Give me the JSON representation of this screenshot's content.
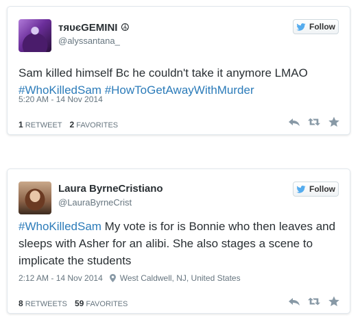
{
  "tweets": [
    {
      "display_name": "тяυєGEMINI ☮",
      "handle": "@alyssantana_",
      "follow_label": "Follow",
      "text_line1": "Sam killed himself Bc he couldn't take it anymore LMAO",
      "hashtag1": "#WhoKilledSam",
      "hashtag2": "#HowToGetAwayWithMurder",
      "timestamp": "5:20 AM - 14 Nov 2014",
      "retweet_count": "1",
      "retweet_label": "RETWEET",
      "favorite_count": "2",
      "favorite_label": "FAVORITES"
    },
    {
      "display_name": "Laura ByrneCristiano",
      "handle": "@LauraByrneCrist",
      "follow_label": "Follow",
      "hashtag": "#WhoKilledSam",
      "text_rest": " My vote is for is Bonnie who then leaves and sleeps with Asher for an alibi. She also stages a scene to implicate the students",
      "timestamp": "2:12 AM - 14 Nov 2014",
      "location": "West Caldwell, NJ, United States",
      "retweet_count": "8",
      "retweet_label": "RETWEETS",
      "favorite_count": "59",
      "favorite_label": "FAVORITES"
    }
  ],
  "colors": {
    "hashtag": "#2b7bb9",
    "text": "#292f33",
    "muted": "#66757f",
    "twitter_blue": "#55acee",
    "border": "#e1e8ed"
  },
  "icons": [
    "twitter-bird-icon",
    "location-pin-icon",
    "reply-icon",
    "retweet-icon",
    "favorite-star-icon"
  ]
}
